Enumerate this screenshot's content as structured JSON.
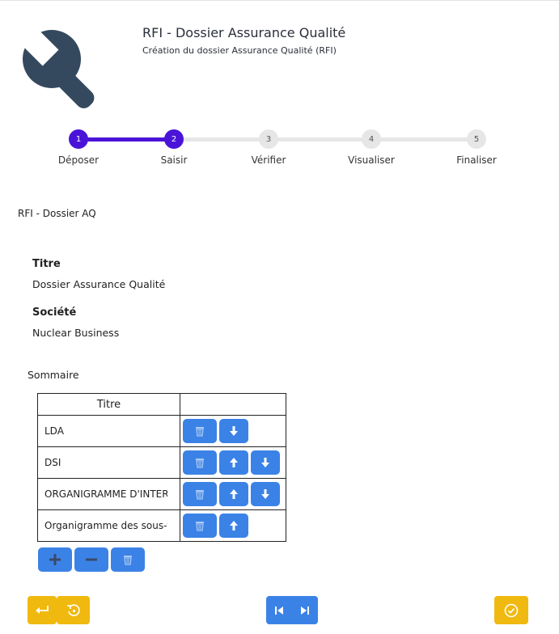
{
  "header": {
    "title": "RFI - Dossier Assurance Qualité",
    "subtitle": "Création du dossier Assurance Qualité (RFI)",
    "logo_icon": "wrench-icon"
  },
  "stepper": {
    "current": 2,
    "steps": [
      {
        "number": "1",
        "label": "Déposer"
      },
      {
        "number": "2",
        "label": "Saisir"
      },
      {
        "number": "3",
        "label": "Vérifier"
      },
      {
        "number": "4",
        "label": "Visualiser"
      },
      {
        "number": "5",
        "label": "Finaliser"
      }
    ]
  },
  "form": {
    "name": "RFI - Dossier AQ",
    "fields": [
      {
        "label": "Titre",
        "value": "Dossier Assurance Qualité"
      },
      {
        "label": "Société",
        "value": "Nuclear Business"
      }
    ],
    "summary": {
      "label": "Sommaire",
      "columns": [
        "Titre",
        ""
      ],
      "rows": [
        {
          "title": "LDA",
          "actions": [
            "delete-icon",
            "arrow-down-icon"
          ]
        },
        {
          "title": "DSI",
          "actions": [
            "delete-icon",
            "arrow-up-icon",
            "arrow-down-icon"
          ]
        },
        {
          "title": "ORGANIGRAMME D'INTERVENANTS",
          "actions": [
            "delete-icon",
            "arrow-up-icon",
            "arrow-down-icon"
          ]
        },
        {
          "title": "Organigramme des sous-traitants",
          "actions": [
            "delete-icon",
            "arrow-up-icon"
          ]
        }
      ],
      "tools": [
        "plus-icon",
        "minus-icon",
        "delete-icon"
      ]
    }
  },
  "footer": {
    "left": [
      "back-icon",
      "reset-icon"
    ],
    "center": [
      "first-page-icon",
      "last-page-icon"
    ],
    "right": [
      "check-circle-icon"
    ]
  },
  "colors": {
    "accent": "#4a14d8",
    "button_blue": "#3b82e6",
    "button_yellow": "#f0b90f",
    "logo": "#34495e"
  }
}
